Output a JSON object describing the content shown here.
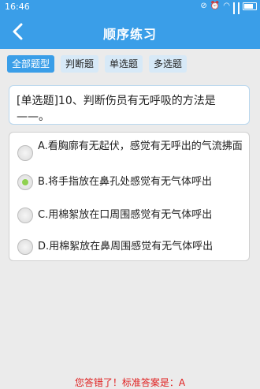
{
  "status_bar": {
    "time": "16:46"
  },
  "header": {
    "title": "顺序练习"
  },
  "tabs": [
    {
      "label": "全部题型",
      "active": true
    },
    {
      "label": "判断题",
      "active": false
    },
    {
      "label": "单选题",
      "active": false
    },
    {
      "label": "多选题",
      "active": false
    }
  ],
  "question": {
    "text": "[单选题]10、判断伤员有无呼吸的方法是——。"
  },
  "options": [
    {
      "label": "A.看胸廓有无起伏，感觉有无呼出的气流拂面",
      "selected": false
    },
    {
      "label": "B.将手指放在鼻孔处感觉有无气体呼出",
      "selected": true
    },
    {
      "label": "C.用棉絮放在口周围感觉有无气体呼出",
      "selected": false
    },
    {
      "label": "D.用棉絮放在鼻周围感觉有无气体呼出",
      "selected": false
    }
  ],
  "result": {
    "text": "您答错了！标准答案是：A"
  },
  "colors": {
    "primary": "#3a9ee8",
    "error": "#e02020",
    "selected_radio": "#8fd14f"
  }
}
